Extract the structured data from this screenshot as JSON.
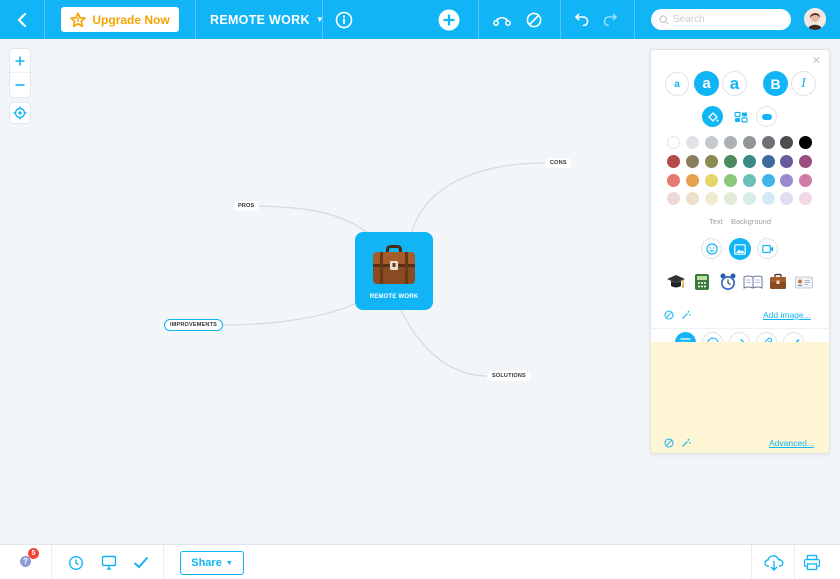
{
  "topbar": {
    "upgrade_label": "Upgrade Now",
    "map_title": "REMOTE WORK",
    "search_placeholder": "Search"
  },
  "map": {
    "central_label": "REMOTE WORK",
    "central_image": "briefcase-icon",
    "nodes": [
      "PROS",
      "CONS",
      "IMPROVEMENTS",
      "SOLUTIONS"
    ]
  },
  "panel": {
    "tabs": [
      "Text",
      "Background"
    ],
    "add_image_label": "Add image...",
    "advanced_label": "Advanced...",
    "images": [
      "graduation-cap-icon",
      "calculator-icon",
      "alarm-clock-icon",
      "open-book-icon",
      "briefcase-icon",
      "id-card-icon"
    ],
    "colors": [
      [
        "#ffffff",
        "#dfe3e7",
        "#c5c9cd",
        "#acb1b6",
        "#919699",
        "#6e7276",
        "#4a4d50",
        "#000000"
      ],
      [
        "#b64a4a",
        "#8c7d5e",
        "#8a8a52",
        "#4e8a5e",
        "#3a8a8a",
        "#3e6a9e",
        "#6a5a9a",
        "#9a4e7e"
      ],
      [
        "#e67a70",
        "#e6a050",
        "#e6d66a",
        "#8cc87a",
        "#6ac0b8",
        "#3fb4e8",
        "#9a8ad0",
        "#d07aa8"
      ],
      [
        "#eed8d6",
        "#eedfcc",
        "#f0ead0",
        "#e0ecd6",
        "#d6ece8",
        "#d4e9f6",
        "#e2dcf0",
        "#f0d8e6"
      ]
    ]
  },
  "bottombar": {
    "share_label": "Share",
    "notifications_count": "5",
    "help_label": "?"
  },
  "colors": {
    "accent": "#11b5f5",
    "upgrade_text": "#f5a300",
    "notes_bg": "#fdf5d4",
    "badge": "#f0473c"
  }
}
